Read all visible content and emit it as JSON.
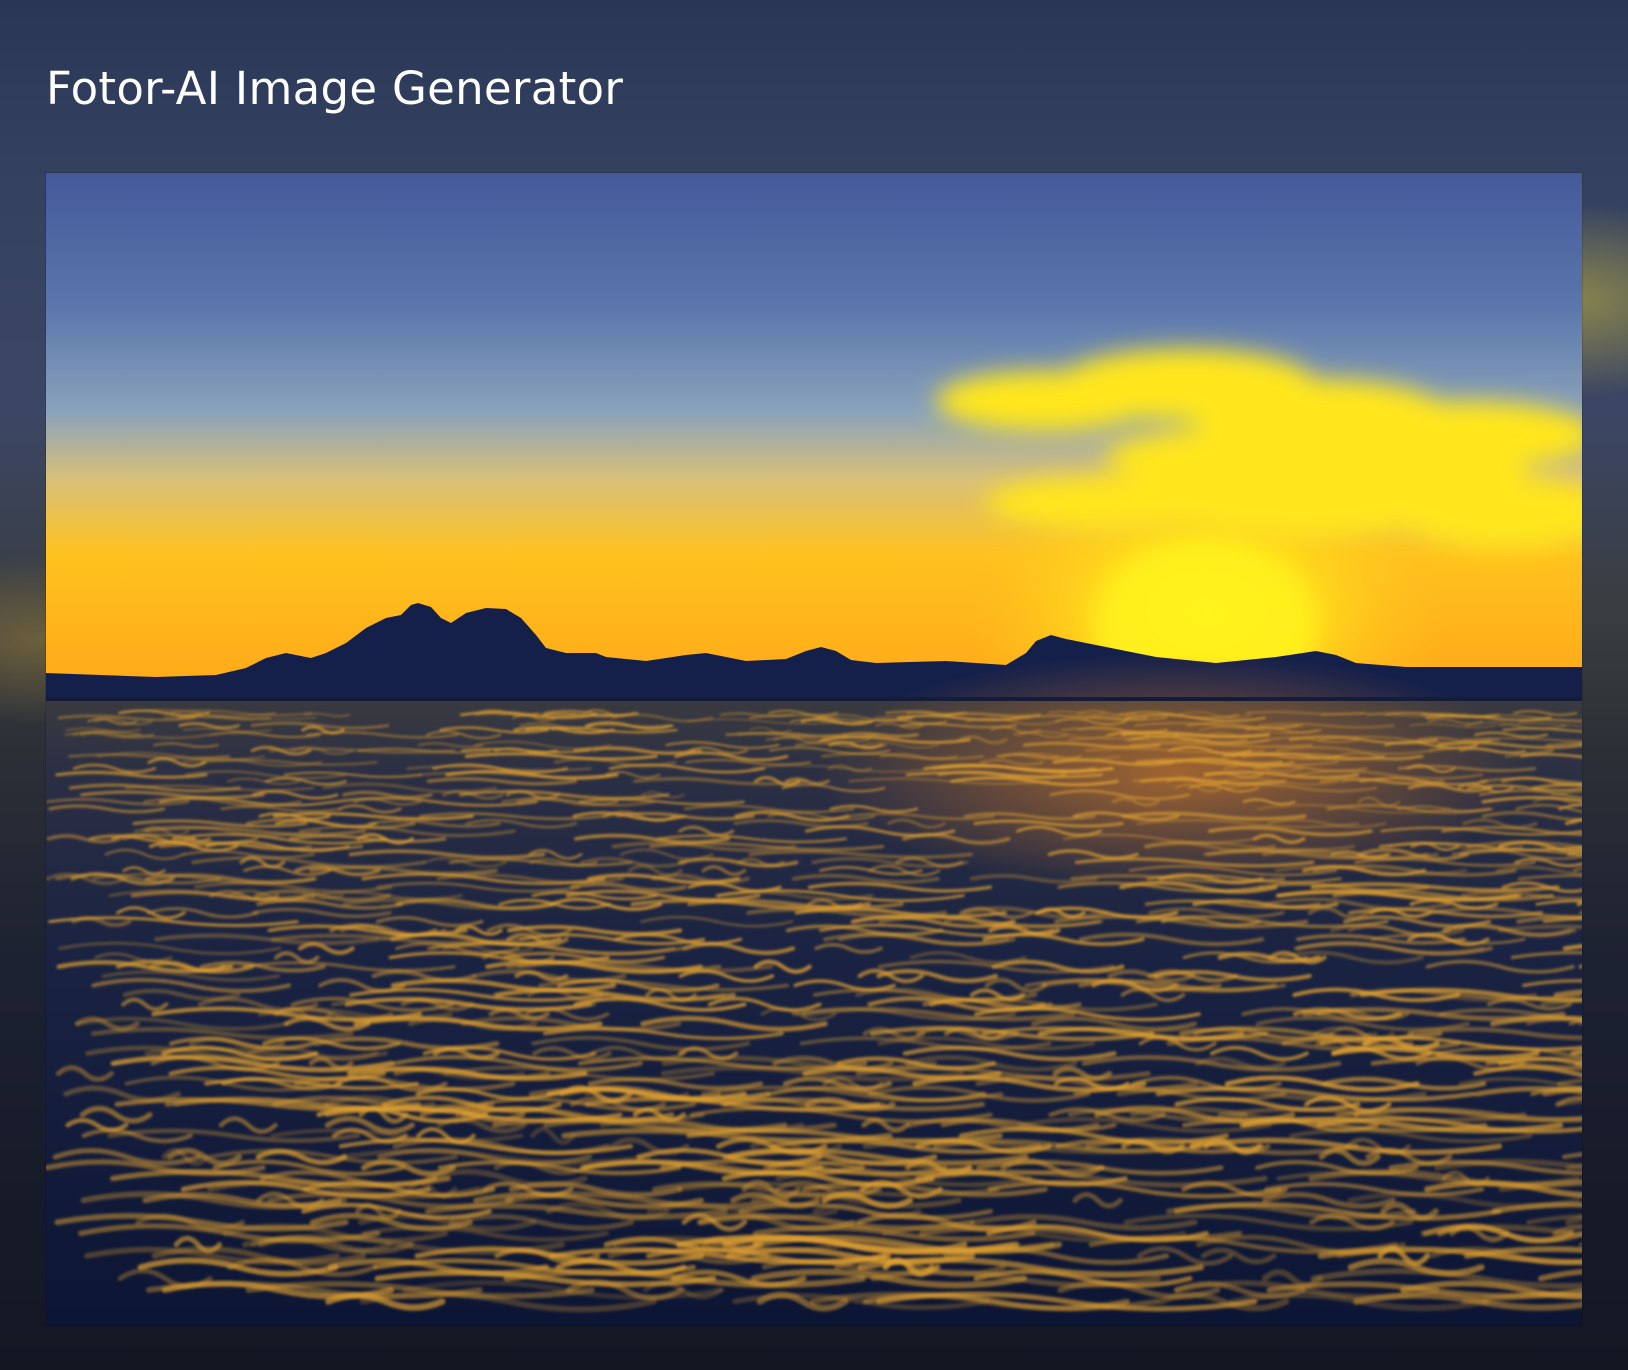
{
  "header": {
    "title": "Fotor-AI Image Generator"
  },
  "image": {
    "subject": "sunset over the sea with distant mountain silhouette and yellow clouds",
    "colors": {
      "sky_top": "#44599a",
      "sky_mid": "#7f98b8",
      "horizon_glow": "#ffb01a",
      "sun": "#fff21a",
      "cloud": "#ffe41c",
      "mountains": "#16204a",
      "sea_dark": "#0e1836",
      "wave_highlight": "#e0a030"
    }
  }
}
